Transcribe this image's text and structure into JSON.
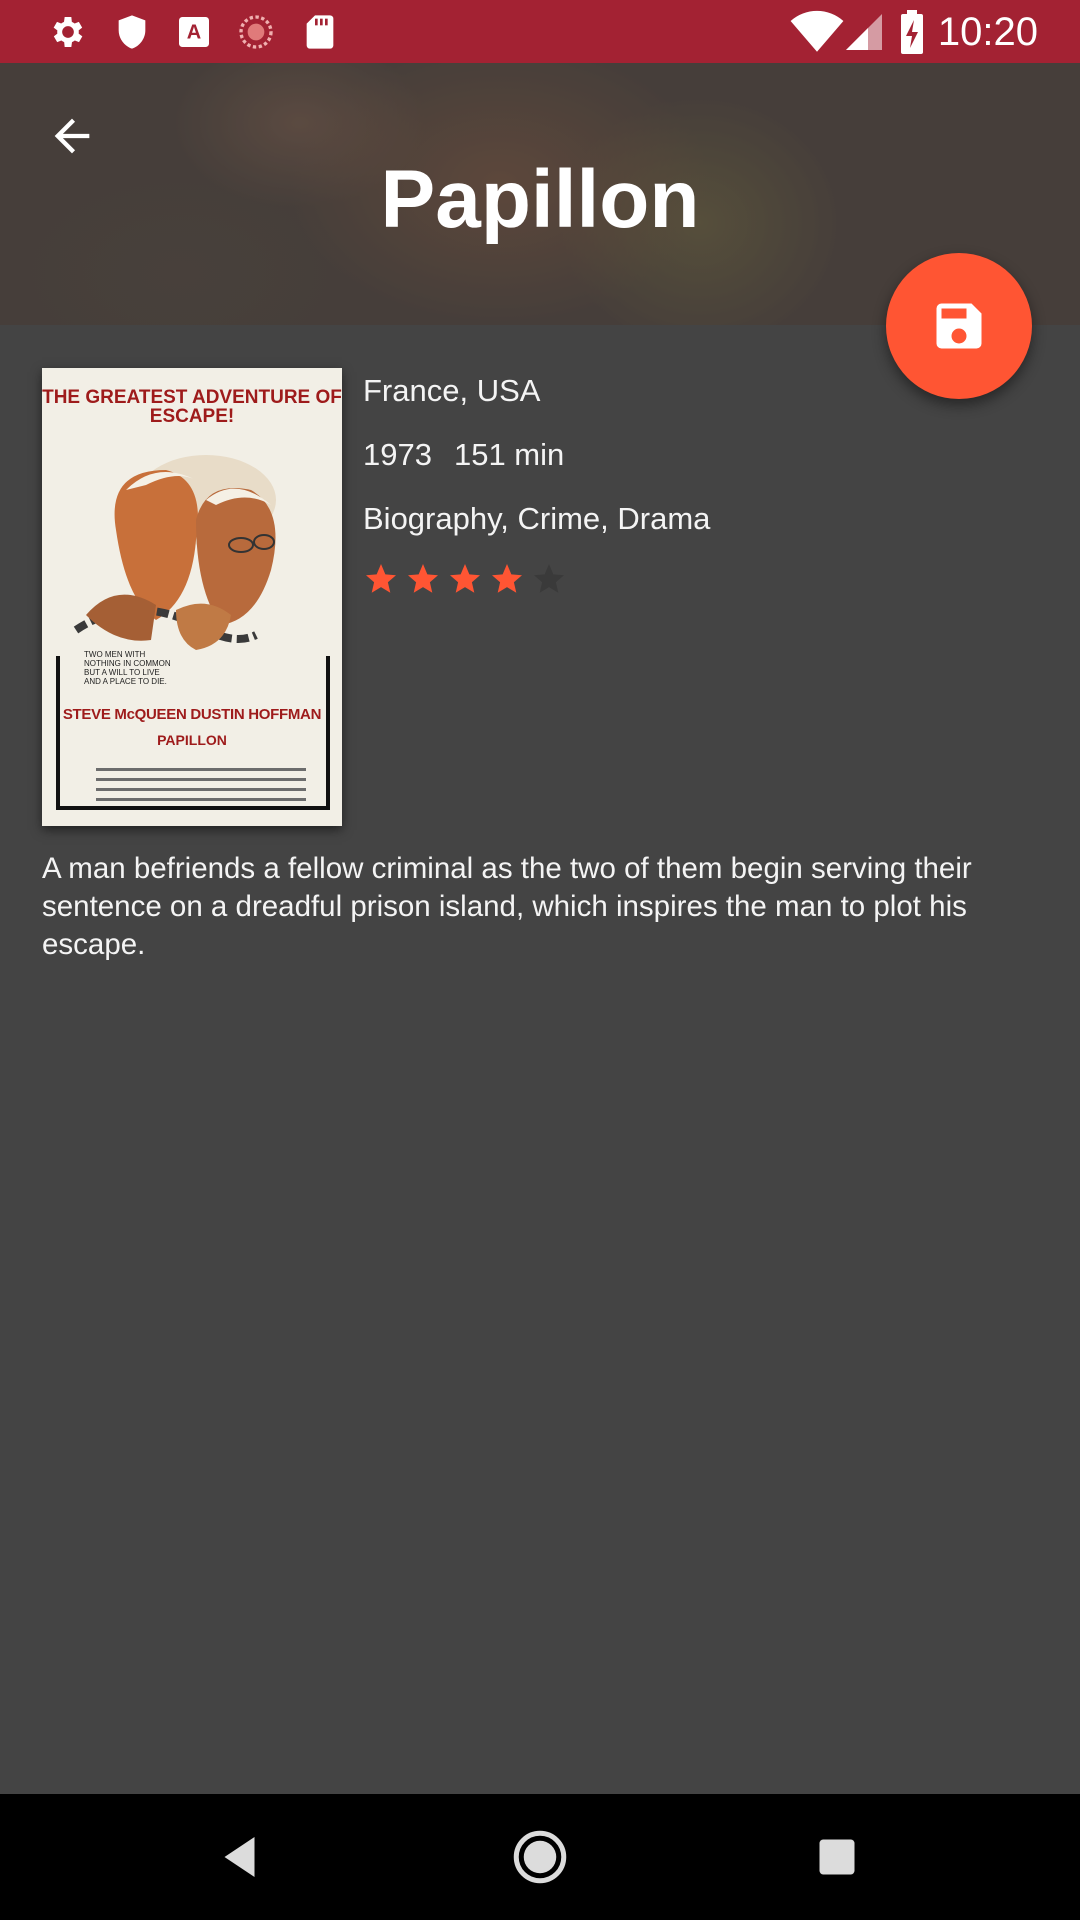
{
  "status_bar": {
    "time": "10:20",
    "left_icons": [
      "gear-icon",
      "shield-icon",
      "font-icon",
      "sync-icon",
      "sd-card-icon"
    ],
    "right_icons": [
      "wifi-icon",
      "cell-signal-icon",
      "battery-charging-icon"
    ]
  },
  "header": {
    "title": "Papillon",
    "back_icon": "arrow-back-icon",
    "save_icon": "floppy-disk-icon",
    "accent_color": "#ff5533"
  },
  "movie": {
    "country": "France, USA",
    "year": "1973",
    "runtime": "151 min",
    "genres": "Biography, Crime, Drama",
    "rating": 4,
    "rating_max": 5,
    "description": "A man befriends a fellow criminal as the two of them begin serving their sentence on a dreadful prison island, which inspires the man to plot his escape."
  },
  "poster": {
    "headline": "THE GREATEST ADVENTURE OF ESCAPE!",
    "tagline": "TWO MEN WITH NOTHING IN COMMON BUT A WILL TO LIVE AND A PLACE TO DIE.",
    "stars": "STEVE McQUEEN DUSTIN HOFFMAN",
    "film_title": "PAPILLON"
  },
  "nav_bar": {
    "icons": [
      "back-triangle-icon",
      "home-circle-icon",
      "recents-square-icon"
    ]
  }
}
